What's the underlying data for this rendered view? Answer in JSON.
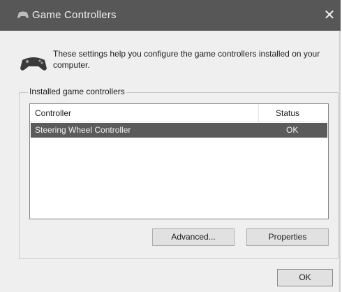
{
  "window": {
    "title": "Game Controllers",
    "close_glyph": "✕"
  },
  "description": "These settings help you configure the game controllers installed on your computer.",
  "group": {
    "label": "Installed game controllers"
  },
  "table": {
    "columns": [
      "Controller",
      "Status"
    ],
    "rows": [
      {
        "controller": "Steering Wheel Controller",
        "status": "OK",
        "selected": true
      }
    ]
  },
  "buttons": {
    "advanced": "Advanced...",
    "properties": "Properties",
    "ok": "OK"
  },
  "icons": {
    "title_icon": "gamepad-icon",
    "main_icon": "gamepad-icon"
  },
  "colors": {
    "titlebar": "#575757",
    "selection": "#5b5b5b",
    "dialog_bg": "#efefef"
  }
}
